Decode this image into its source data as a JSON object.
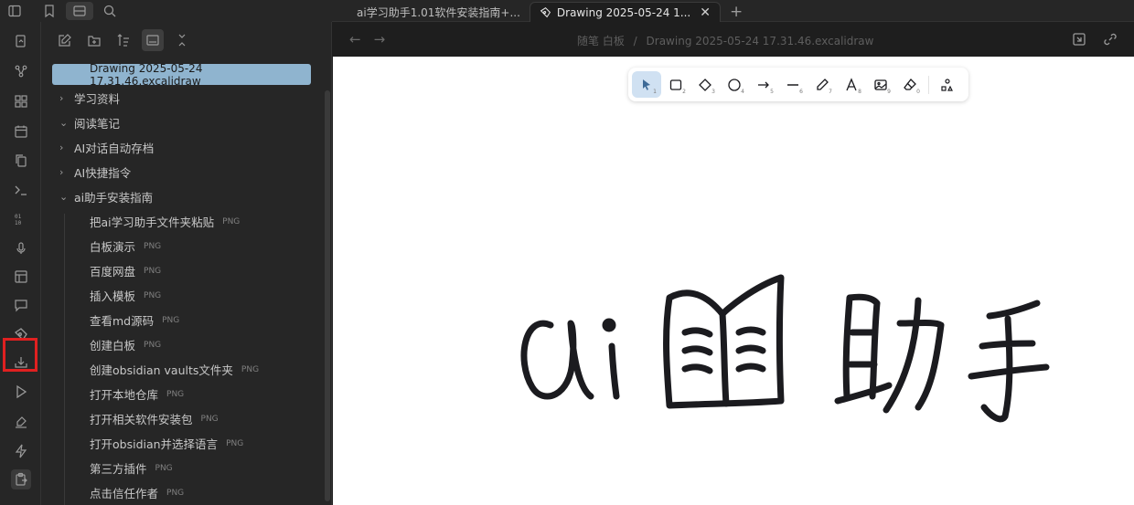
{
  "tabs": [
    {
      "label": "ai学习助手1.01软件安装指南+...",
      "active": false
    },
    {
      "label": "Drawing 2025-05-24 1...",
      "active": true
    }
  ],
  "breadcrumb": {
    "folder": "随笔 白板",
    "sep": "/",
    "file": "Drawing 2025-05-24 17.31.46.excalidraw"
  },
  "sidebar": {
    "active_file": "Drawing 2025-05-24 17.31.46.excalidraw",
    "folders": [
      {
        "label": "学习资料",
        "expanded": false
      },
      {
        "label": "阅读笔记",
        "expanded": true
      },
      {
        "label": "AI对话自动存档",
        "expanded": false
      },
      {
        "label": "AI快捷指令",
        "expanded": false
      },
      {
        "label": "ai助手安装指南",
        "expanded": true
      }
    ],
    "files": [
      {
        "name": "把ai学习助手文件夹粘贴",
        "ext": "PNG"
      },
      {
        "name": "白板演示",
        "ext": "PNG"
      },
      {
        "name": "百度网盘",
        "ext": "PNG"
      },
      {
        "name": "插入模板",
        "ext": "PNG"
      },
      {
        "name": "查看md源码",
        "ext": "PNG"
      },
      {
        "name": "创建白板",
        "ext": "PNG"
      },
      {
        "name": "创建obsidian vaults文件夹",
        "ext": "PNG"
      },
      {
        "name": "打开本地仓库",
        "ext": "PNG"
      },
      {
        "name": "打开相关软件安装包",
        "ext": "PNG"
      },
      {
        "name": "打开obsidian并选择语言",
        "ext": "PNG"
      },
      {
        "name": "第三方插件",
        "ext": "PNG"
      },
      {
        "name": "点击信任作者",
        "ext": "PNG"
      }
    ]
  },
  "toolbar": {
    "tools": [
      {
        "name": "selection-tool",
        "num": "1"
      },
      {
        "name": "rectangle-tool",
        "num": "2"
      },
      {
        "name": "diamond-tool",
        "num": "3"
      },
      {
        "name": "ellipse-tool",
        "num": "4"
      },
      {
        "name": "arrow-tool",
        "num": "5"
      },
      {
        "name": "line-tool",
        "num": "6"
      },
      {
        "name": "draw-tool",
        "num": "7"
      },
      {
        "name": "text-tool",
        "num": "8"
      },
      {
        "name": "image-tool",
        "num": "9"
      },
      {
        "name": "eraser-tool",
        "num": "0"
      },
      {
        "name": "library-tool",
        "num": ""
      }
    ]
  },
  "colors": {
    "accent": "#8fb4cf",
    "highlight_box": "#e02020",
    "selected_tool": "#d0e1f2"
  }
}
